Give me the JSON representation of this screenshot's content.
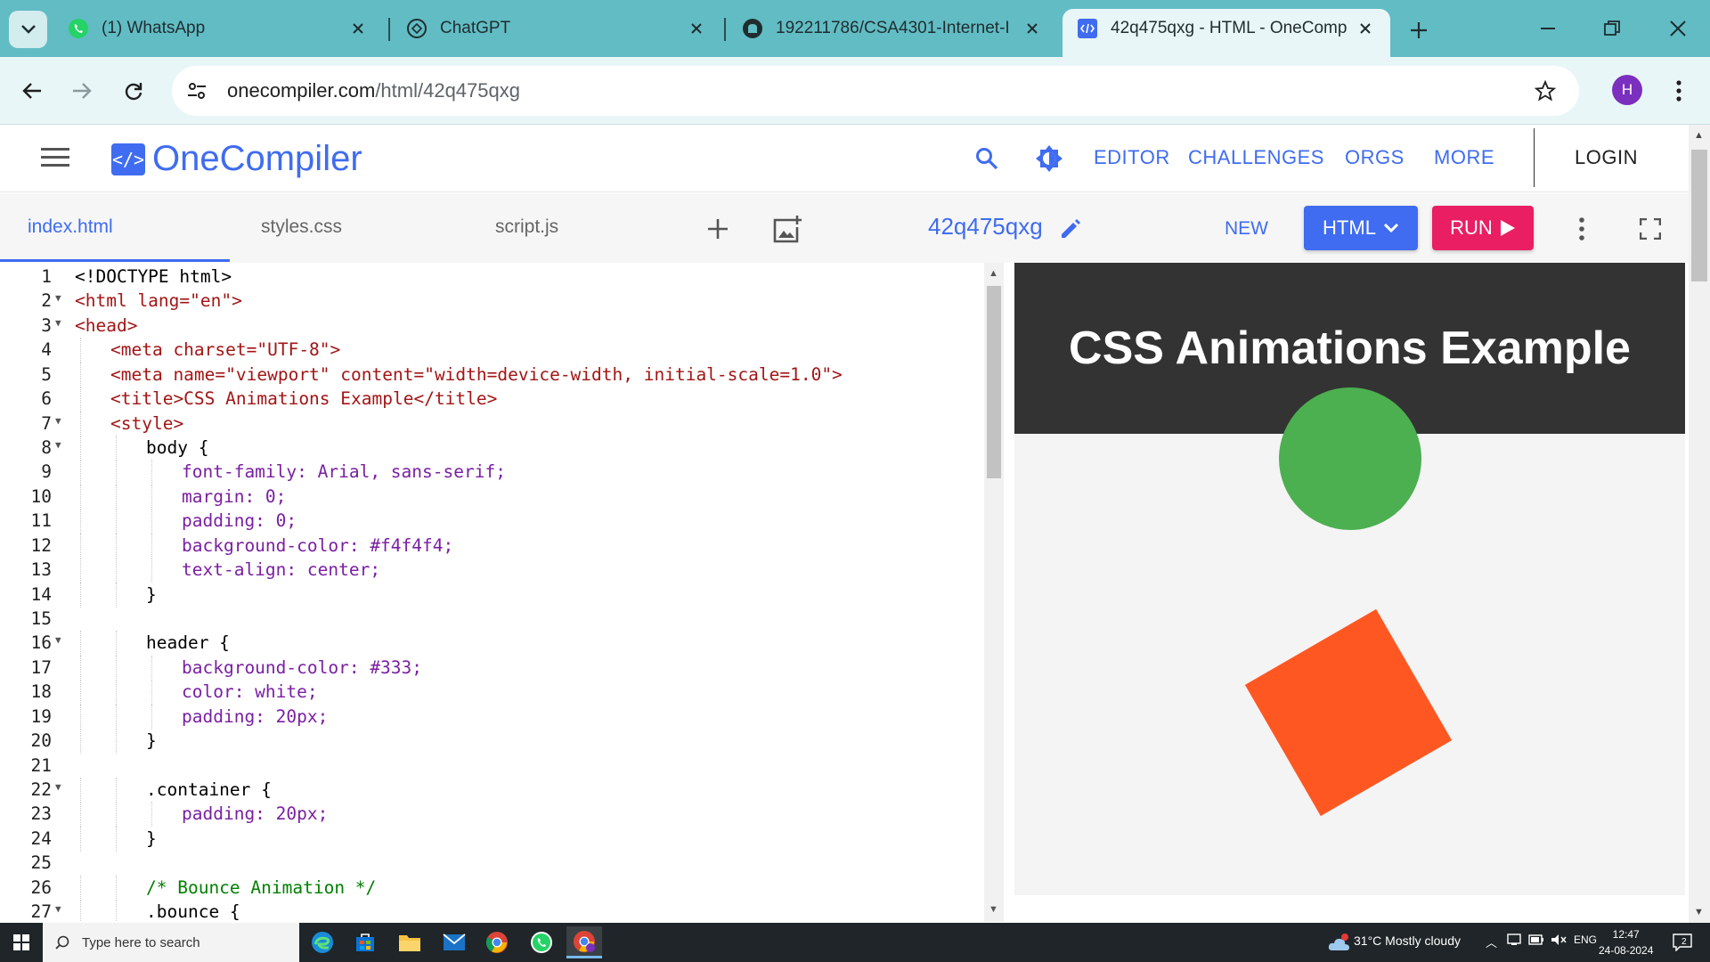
{
  "browser": {
    "tabs": [
      {
        "title": "(1) WhatsApp",
        "favicon": "whatsapp-icon"
      },
      {
        "title": "ChatGPT",
        "favicon": "chatgpt-icon"
      },
      {
        "title": "192211786/CSA4301-Internet-I",
        "favicon": "github-icon"
      },
      {
        "title": "42q475qxg - HTML - OneComp",
        "favicon": "onecompiler-icon",
        "active": true
      }
    ],
    "url_domain": "onecompiler.com",
    "url_path": "/html/42q475qxg",
    "profile_initial": "H"
  },
  "site": {
    "logo_mark": "</>",
    "logo_text": "OneCompiler",
    "nav": [
      "EDITOR",
      "CHALLENGES",
      "ORGS",
      "MORE"
    ],
    "login": "LOGIN",
    "accent": "#3f6cf0"
  },
  "toolbar": {
    "files": [
      "index.html",
      "styles.css",
      "script.js"
    ],
    "active_file": "index.html",
    "project_name": "42q475qxg",
    "new_label": "NEW",
    "language_label": "HTML",
    "run_label": "RUN",
    "run_color": "#e91e63"
  },
  "editor": {
    "lines": [
      {
        "n": "1",
        "text": "<!DOCTYPE html>",
        "indent": 0,
        "fold": false,
        "cls": ""
      },
      {
        "n": "2",
        "text": "<html lang=\"en\">",
        "indent": 0,
        "fold": true,
        "cls": "tag"
      },
      {
        "n": "3",
        "text": "<head>",
        "indent": 0,
        "fold": true,
        "cls": "tag"
      },
      {
        "n": "4",
        "text": "<meta charset=\"UTF-8\">",
        "indent": 1,
        "fold": false,
        "cls": "tag"
      },
      {
        "n": "5",
        "text": "<meta name=\"viewport\" content=\"width=device-width, initial-scale=1.0\">",
        "indent": 1,
        "fold": false,
        "cls": "tag"
      },
      {
        "n": "6",
        "text": "<title>CSS Animations Example</title>",
        "indent": 1,
        "fold": false,
        "cls": "title"
      },
      {
        "n": "7",
        "text": "<style>",
        "indent": 1,
        "fold": true,
        "cls": "tag"
      },
      {
        "n": "8",
        "text": "body {",
        "indent": 2,
        "fold": true,
        "cls": ""
      },
      {
        "n": "9",
        "text": "font-family: Arial, sans-serif;",
        "indent": 3,
        "fold": false,
        "cls": "prop"
      },
      {
        "n": "10",
        "text": "margin: 0;",
        "indent": 3,
        "fold": false,
        "cls": "prop"
      },
      {
        "n": "11",
        "text": "padding: 0;",
        "indent": 3,
        "fold": false,
        "cls": "prop"
      },
      {
        "n": "12",
        "text": "background-color: #f4f4f4;",
        "indent": 3,
        "fold": false,
        "cls": "prop"
      },
      {
        "n": "13",
        "text": "text-align: center;",
        "indent": 3,
        "fold": false,
        "cls": "prop"
      },
      {
        "n": "14",
        "text": "}",
        "indent": 2,
        "fold": false,
        "cls": ""
      },
      {
        "n": "15",
        "text": "",
        "indent": 0,
        "fold": false,
        "cls": ""
      },
      {
        "n": "16",
        "text": "header {",
        "indent": 2,
        "fold": true,
        "cls": ""
      },
      {
        "n": "17",
        "text": "background-color: #333;",
        "indent": 3,
        "fold": false,
        "cls": "prop"
      },
      {
        "n": "18",
        "text": "color: white;",
        "indent": 3,
        "fold": false,
        "cls": "prop"
      },
      {
        "n": "19",
        "text": "padding: 20px;",
        "indent": 3,
        "fold": false,
        "cls": "prop"
      },
      {
        "n": "20",
        "text": "}",
        "indent": 2,
        "fold": false,
        "cls": ""
      },
      {
        "n": "21",
        "text": "",
        "indent": 0,
        "fold": false,
        "cls": ""
      },
      {
        "n": "22",
        "text": ".container {",
        "indent": 2,
        "fold": true,
        "cls": ""
      },
      {
        "n": "23",
        "text": "padding: 20px;",
        "indent": 3,
        "fold": false,
        "cls": "prop"
      },
      {
        "n": "24",
        "text": "}",
        "indent": 2,
        "fold": false,
        "cls": ""
      },
      {
        "n": "25",
        "text": "",
        "indent": 0,
        "fold": false,
        "cls": ""
      },
      {
        "n": "26",
        "text": "/* Bounce Animation */",
        "indent": 2,
        "fold": false,
        "cls": "comment"
      },
      {
        "n": "27",
        "text": ".bounce {",
        "indent": 2,
        "fold": true,
        "cls": ""
      }
    ]
  },
  "preview": {
    "header_title": "CSS Animations Example",
    "header_bg": "#333333",
    "circle_color": "#4caf50",
    "square_color": "#ff5722",
    "bg": "#f4f4f4"
  },
  "taskbar": {
    "search_placeholder": "Type here to search",
    "weather": "31°C  Mostly cloudy",
    "language": "ENG",
    "time": "12:47",
    "date": "24-08-2024",
    "notifications": "2"
  }
}
